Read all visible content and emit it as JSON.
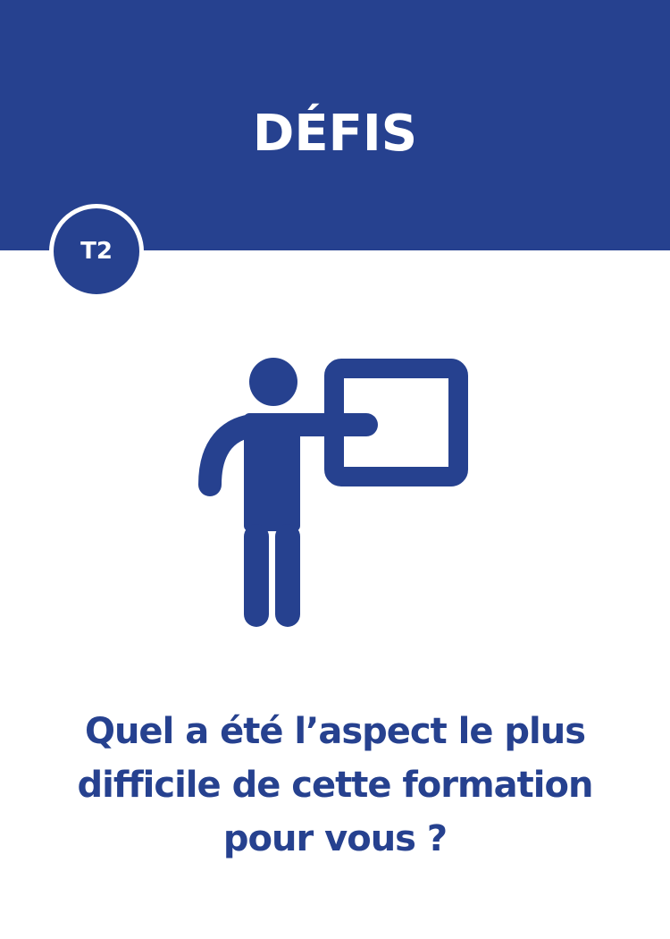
{
  "card": {
    "title": "DÉFIS",
    "badge": "T2",
    "question": "Quel a été l’aspect le plus difficile de cette formation pour vous ?",
    "illustration_icon": "presenter-at-board-icon"
  },
  "colors": {
    "brand_blue": "#26418f",
    "background": "#ffffff"
  }
}
